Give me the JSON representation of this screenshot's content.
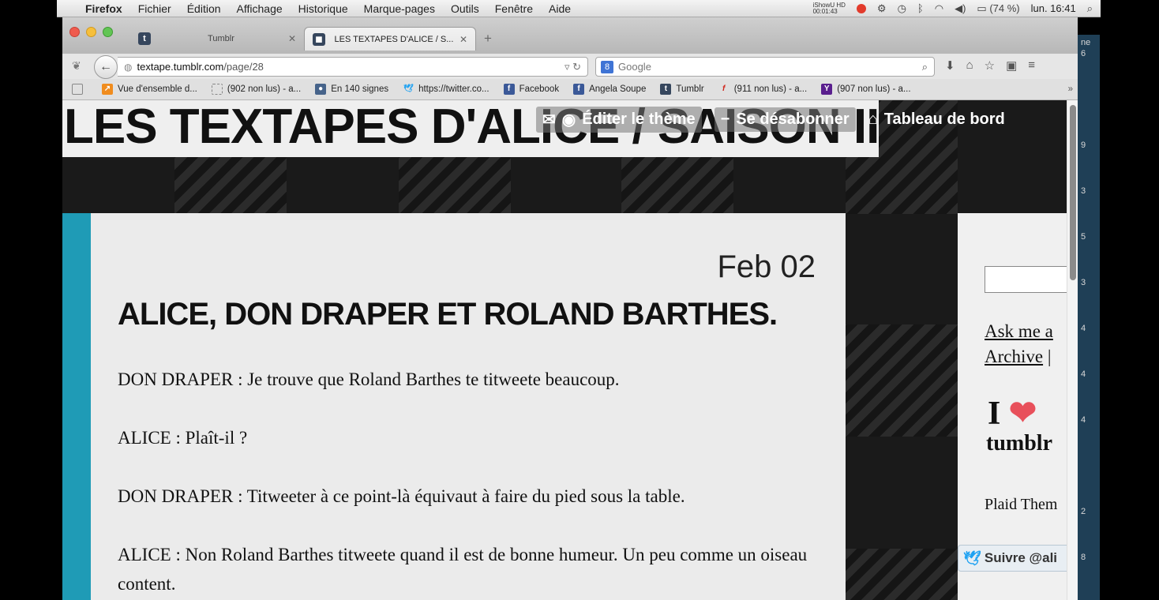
{
  "menubar": {
    "items": [
      "Firefox",
      "Fichier",
      "Édition",
      "Affichage",
      "Historique",
      "Marque-pages",
      "Outils",
      "Fenêtre",
      "Aide"
    ],
    "recorder": "iShowU HD",
    "recorder_time": "00:01:43",
    "battery": "(74 %)",
    "clock": "lun. 16:41"
  },
  "tabs": [
    {
      "title": "Tumblr",
      "active": false
    },
    {
      "title": "LES TEXTAPES D'ALICE / S...",
      "active": true
    }
  ],
  "navbar": {
    "url_host": "textape.tumblr.com",
    "url_path": "/page/28",
    "search_placeholder": "Google"
  },
  "bookmarks": [
    {
      "label": "",
      "icon": "blank-icon"
    },
    {
      "label": "Vue d'ensemble d...",
      "icon": "chart-icon"
    },
    {
      "label": "(902 non lus) - a...",
      "icon": "blank-icon"
    },
    {
      "label": "En 140 signes",
      "icon": "head-icon"
    },
    {
      "label": "https://twitter.co...",
      "icon": "twitter-icon"
    },
    {
      "label": "Facebook",
      "icon": "facebook-icon"
    },
    {
      "label": "Angela Soupe",
      "icon": "facebook-icon"
    },
    {
      "label": "Tumblr",
      "icon": "tumblr-icon"
    },
    {
      "label": "(911 non lus) - a...",
      "icon": "free-icon"
    },
    {
      "label": "(907 non lus) - a...",
      "icon": "yahoo-icon"
    }
  ],
  "blog": {
    "title": "LES TEXTAPES D'ALICE / SAISON II",
    "controls": {
      "edit_theme": "Éditer le thème",
      "unfollow": "Se désabonner",
      "dashboard": "Tableau de bord"
    }
  },
  "post": {
    "date": "Feb 02",
    "title": "ALICE, DON DRAPER ET ROLAND BARTHES.",
    "paragraphs": [
      "DON DRAPER : Je trouve que Roland Barthes te titweete beaucoup.",
      "ALICE : Plaît-il ?",
      "DON DRAPER : Titweeter à ce point-là équivaut à faire du pied sous la table.",
      "ALICE : Non Roland Barthes titweete quand il est de bonne humeur. Un peu comme un oiseau content."
    ]
  },
  "sidebar": {
    "ask_link": "Ask me a",
    "archive_link": "Archive",
    "separator": "|",
    "i_heart": "I",
    "tumblr_word": "tumblr",
    "theme_credit": "Plaid Them",
    "follow": "Suivre @ali"
  },
  "edge_labels": [
    "ne",
    "6",
    "9",
    "3",
    "5",
    "3",
    "4",
    "4",
    "4",
    "2",
    "8"
  ],
  "colors": {
    "accent": "#1f9bb6",
    "heart": "#e8505b",
    "twitter": "#1da1f2"
  }
}
